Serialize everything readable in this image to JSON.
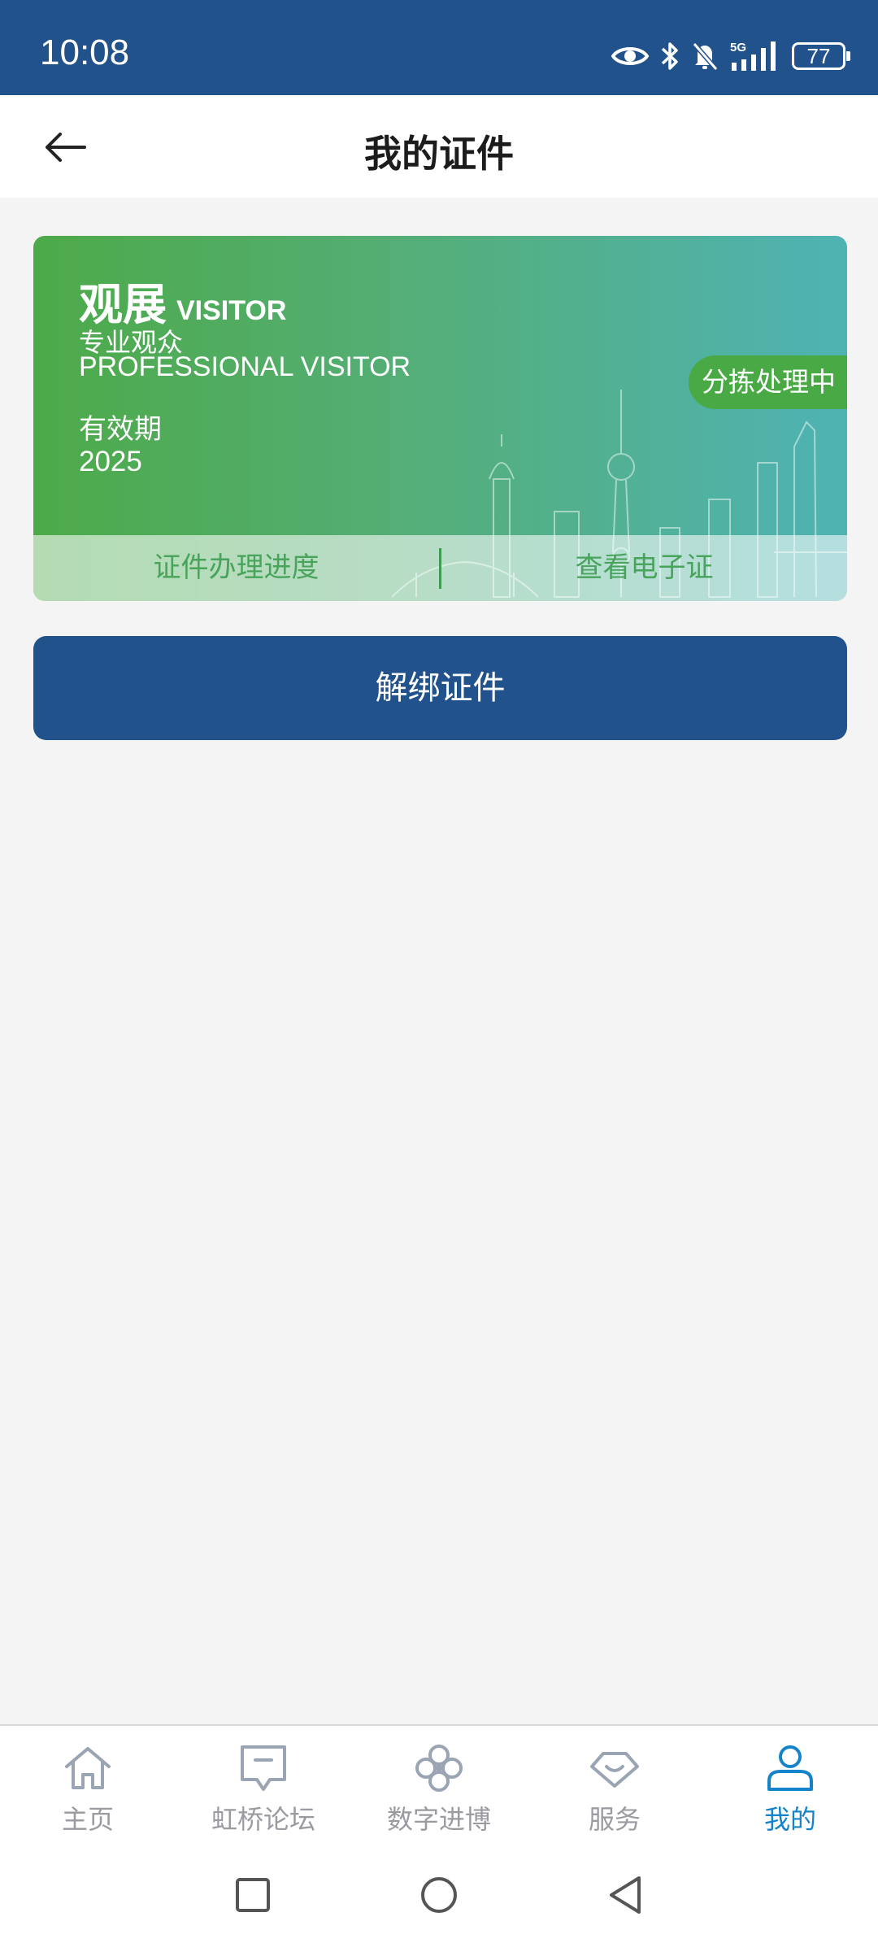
{
  "status_bar": {
    "time": "10:08",
    "network": "5G",
    "battery": "77",
    "icons": [
      "eye-icon",
      "bluetooth-icon",
      "bell-off-icon",
      "signal-icon",
      "battery-icon"
    ]
  },
  "header": {
    "title": "我的证件",
    "back_icon": "arrow-left-icon"
  },
  "card": {
    "title_cn": "观展",
    "title_en": "VISITOR",
    "subtitle_cn": "专业观众",
    "subtitle_en": "PROFESSIONAL VISITOR",
    "valid_label": "有效期",
    "valid_year": "2025",
    "status": "分拣处理中",
    "action_progress": "证件办理进度",
    "action_view": "查看电子证",
    "gradient_colors": [
      "#4daa48",
      "#4fb3b4"
    ],
    "status_color": "#49a944",
    "action_text_color": "#47a45a"
  },
  "unbind_button": {
    "label": "解绑证件",
    "color": "#21528b"
  },
  "tabbar": {
    "items": [
      {
        "label": "主页",
        "icon": "home-icon",
        "active": false
      },
      {
        "label": "虹桥论坛",
        "icon": "forum-icon",
        "active": false
      },
      {
        "label": "数字进博",
        "icon": "clover-icon",
        "active": false
      },
      {
        "label": "服务",
        "icon": "service-icon",
        "active": false
      },
      {
        "label": "我的",
        "icon": "user-icon",
        "active": true
      }
    ],
    "active_color": "#1583c9",
    "inactive_color": "#9a9aa0"
  },
  "system_nav": [
    "recent-apps-icon",
    "home-circle-icon",
    "back-triangle-icon"
  ],
  "theme": {
    "primary": "#21528b",
    "background": "#f4f4f4"
  }
}
